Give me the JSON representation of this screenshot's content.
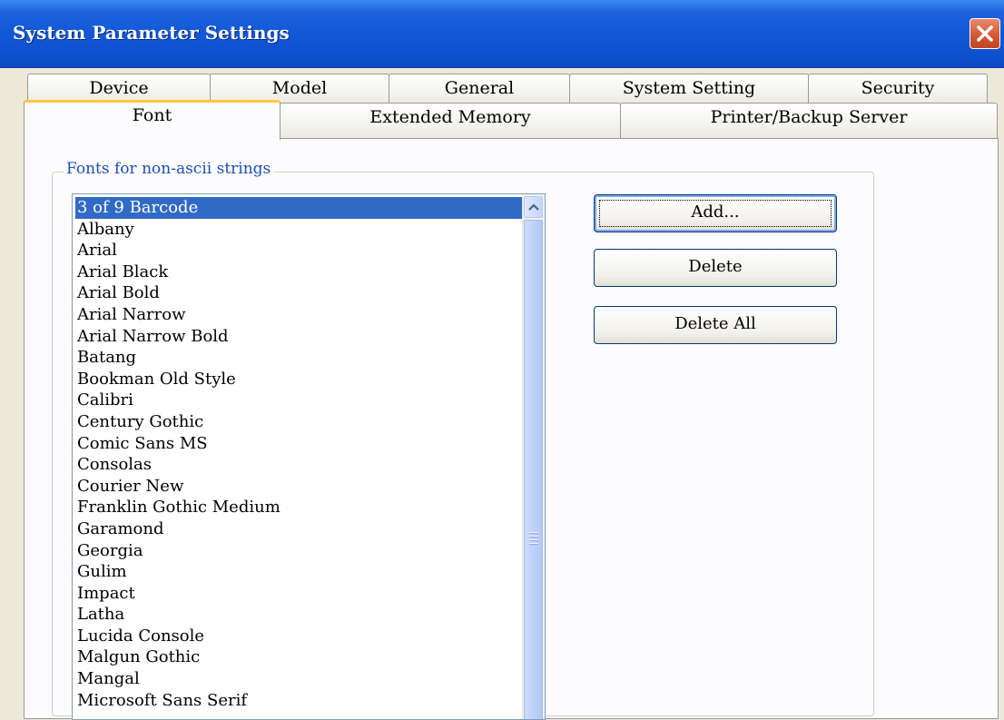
{
  "window": {
    "title": "System Parameter Settings",
    "close_icon": "close-icon",
    "accent_color": "#1258d6",
    "close_color": "#d35a37"
  },
  "tabs": {
    "row_back": [
      "Device",
      "Model",
      "General",
      "System Setting",
      "Security"
    ],
    "row_front": [
      "Font",
      "Extended Memory",
      "Printer/Backup Server"
    ],
    "active": "Font"
  },
  "font_group": {
    "label": "Fonts for non-ascii strings",
    "selected_index": 0,
    "selection_color": "#316ac5",
    "items": [
      "3 of 9 Barcode",
      "Albany",
      "Arial",
      "Arial Black",
      "Arial Bold",
      "Arial Narrow",
      "Arial Narrow Bold",
      "Batang",
      "Bookman Old Style",
      "Calibri",
      "Century Gothic",
      "Comic Sans MS",
      "Consolas",
      "Courier New",
      "Franklin Gothic Medium",
      "Garamond",
      "Georgia",
      "Gulim",
      "Impact",
      "Latha",
      "Lucida Console",
      "Malgun Gothic",
      "Mangal",
      "Microsoft Sans Serif"
    ]
  },
  "buttons": {
    "add": "Add...",
    "delete": "Delete",
    "delete_all": "Delete All"
  }
}
